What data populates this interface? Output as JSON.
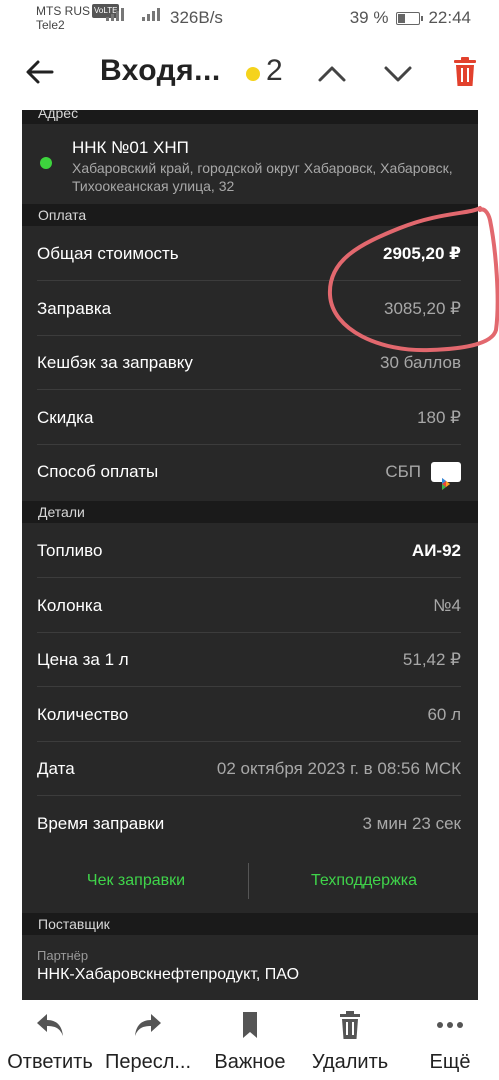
{
  "status_bar": {
    "carrier1": "MTS RUS",
    "volte": "VoLTE",
    "carrier2": "Tele2",
    "network": "4G",
    "speed": "326B/s",
    "battery": "39 %",
    "battery_level": 0.39,
    "time": "22:44"
  },
  "header": {
    "title": "Входя...",
    "unread_count": "2",
    "accent_color": "#f5d31c",
    "delete_color": "#e2412d"
  },
  "address": {
    "section": "Адрес",
    "station_name": "ННК №01 ХНП",
    "full_address": "Хабаровский край, городской округ Хабаровск, Хабаровск, Тихоокеанская улица, 32"
  },
  "payment": {
    "section": "Оплата",
    "rows": [
      {
        "label": "Общая стоимость",
        "value": "2905,20 ₽"
      },
      {
        "label": "Заправка",
        "value": "3085,20 ₽"
      },
      {
        "label": "Кешбэк за заправку",
        "value": "30 баллов"
      },
      {
        "label": "Скидка",
        "value": "180 ₽"
      },
      {
        "label": "Способ оплаты",
        "value": "СБП"
      }
    ]
  },
  "details": {
    "section": "Детали",
    "rows": [
      {
        "label": "Топливо",
        "value": "АИ-92"
      },
      {
        "label": "Колонка",
        "value": "№4"
      },
      {
        "label": "Цена за 1 л",
        "value": "51,42 ₽"
      },
      {
        "label": "Количество",
        "value": "60 л"
      },
      {
        "label": "Дата",
        "value": "02 октября 2023 г. в 08:56 МСК"
      },
      {
        "label": "Время заправки",
        "value": "3 мин 23 сек"
      }
    ],
    "receipt_link": "Чек заправки",
    "support_link": "Техподдержка",
    "link_color": "#3fd44a"
  },
  "supplier": {
    "section": "Поставщик",
    "partner_label": "Партнёр",
    "partner_name": "ННК-Хабаровскнефтепродукт, ПАО"
  },
  "bottom_bar": {
    "reply": "Ответить",
    "forward": "Пересл...",
    "important": "Важное",
    "delete": "Удалить",
    "more": "Ещё"
  }
}
